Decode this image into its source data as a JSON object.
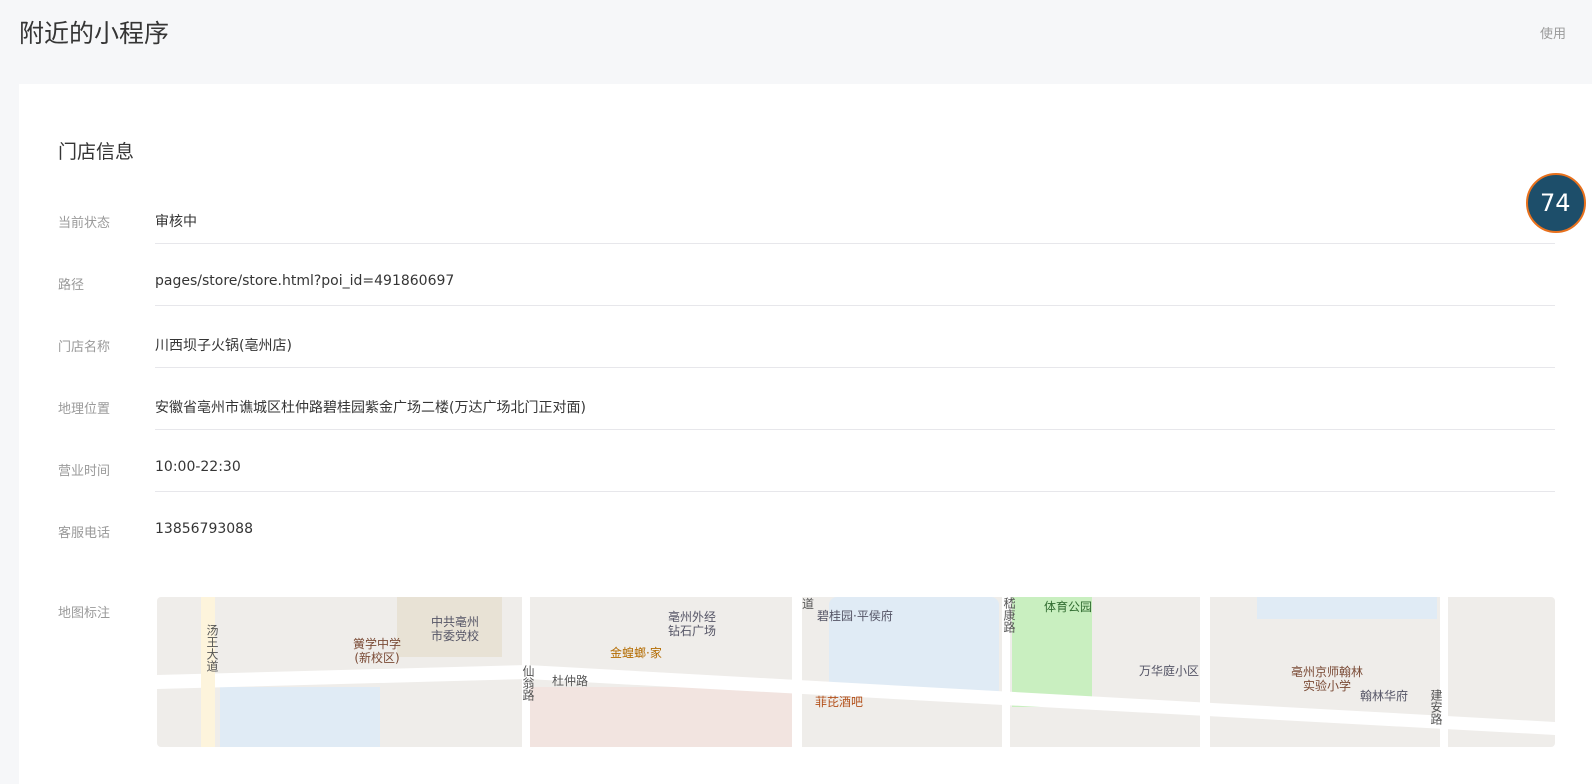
{
  "header": {
    "title": "附近的小程序",
    "usage": "使用"
  },
  "section_title": "门店信息",
  "rows": [
    {
      "label": "当前状态",
      "value": "审核中"
    },
    {
      "label": "路径",
      "value": "pages/store/store.html?poi_id=491860697"
    },
    {
      "label": "门店名称",
      "value": "川西坝子火锅(亳州店)"
    },
    {
      "label": "地理位置",
      "value": "安徽省亳州市谯城区杜仲路碧桂园紫金广场二楼(万达广场北门正对面)"
    },
    {
      "label": "营业时间",
      "value": "10:00-22:30"
    },
    {
      "label": "客服电话",
      "value": "13856793088"
    }
  ],
  "map": {
    "label": "地图标注",
    "places": [
      "汤王大道",
      "黉学中学(新校区)",
      "中共亳州市委党校",
      "亳州外经钻石广场",
      "金蝗螂·家",
      "仙翁路",
      "杜仲路",
      "碧桂园·平侯府",
      "嵇康路",
      "体育公园",
      "万华庭小区",
      "亳州京师翰林实验小学",
      "翰林华府",
      "建安路",
      "菲芘酒吧",
      "道"
    ]
  },
  "float_badge": {
    "value": "74"
  }
}
